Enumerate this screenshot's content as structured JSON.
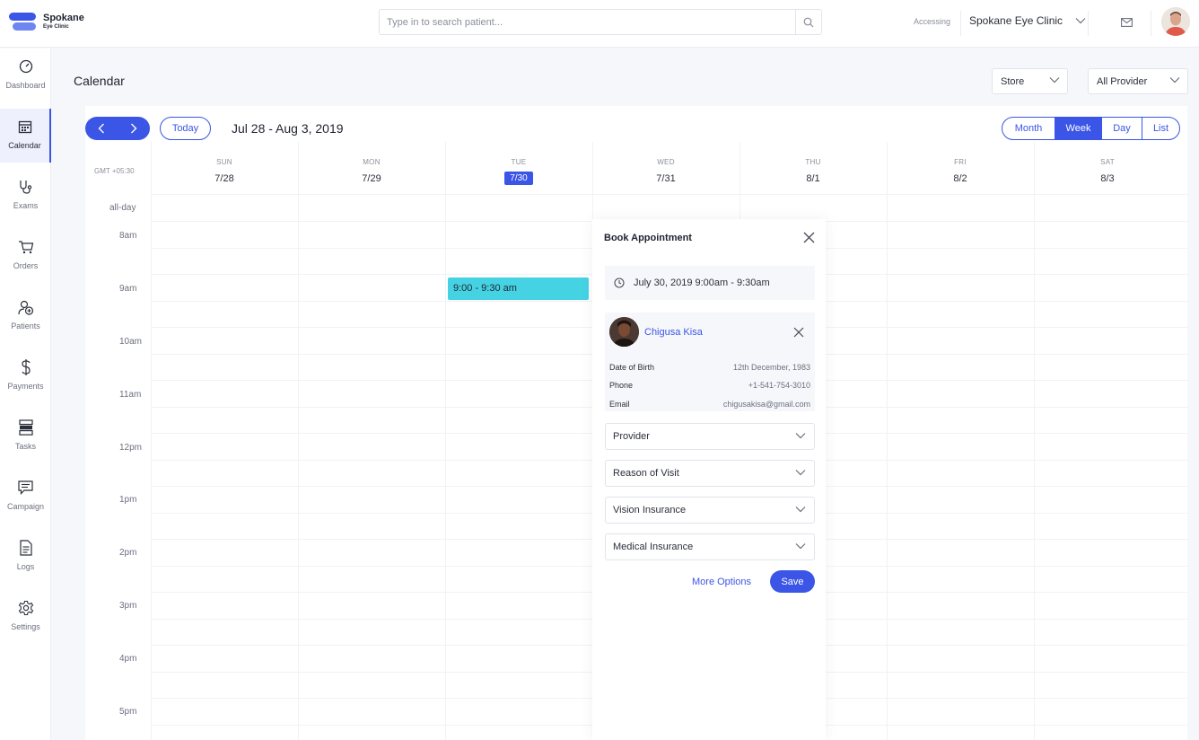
{
  "brand": {
    "name": "Spokane",
    "sub": "Eye Clinic"
  },
  "search": {
    "placeholder": "Type in to search patient..."
  },
  "header": {
    "accessing_label": "Accessing",
    "clinic": "Spokane Eye Clinic"
  },
  "sidebar": {
    "items": [
      {
        "label": "Dashboard",
        "icon": "speedometer-icon"
      },
      {
        "label": "Calendar",
        "icon": "calendar-icon",
        "active": true
      },
      {
        "label": "Exams",
        "icon": "stethoscope-icon"
      },
      {
        "label": "Orders",
        "icon": "cart-icon"
      },
      {
        "label": "Patients",
        "icon": "add-patient-icon"
      },
      {
        "label": "Payments",
        "icon": "dollar-icon"
      },
      {
        "label": "Tasks",
        "icon": "tasks-icon"
      },
      {
        "label": "Campaign",
        "icon": "message-icon"
      },
      {
        "label": "Logs",
        "icon": "document-icon"
      },
      {
        "label": "Settings",
        "icon": "gear-icon"
      }
    ]
  },
  "page": {
    "title": "Calendar",
    "store_select": "Store",
    "provider_select": "All Provider"
  },
  "calendar": {
    "today_label": "Today",
    "range": "Jul 28 - Aug 3, 2019",
    "views": [
      "Month",
      "Week",
      "Day",
      "List"
    ],
    "active_view": "Week",
    "timezone": "GMT +05:30",
    "allday_label": "all-day",
    "days": [
      {
        "name": "SUN",
        "date": "7/28"
      },
      {
        "name": "MON",
        "date": "7/29"
      },
      {
        "name": "TUE",
        "date": "7/30",
        "today": true
      },
      {
        "name": "WED",
        "date": "7/31"
      },
      {
        "name": "THU",
        "date": "8/1"
      },
      {
        "name": "FRI",
        "date": "8/2"
      },
      {
        "name": "SAT",
        "date": "8/3"
      }
    ],
    "hours": [
      "8am",
      "9am",
      "10am",
      "11am",
      "12pm",
      "1pm",
      "2pm",
      "3pm",
      "4pm",
      "5pm"
    ],
    "event": {
      "label": "9:00 - 9:30 am",
      "color": "#45d3e4"
    }
  },
  "popup": {
    "title": "Book Appointment",
    "datetime": "July 30, 2019 9:00am - 9:30am",
    "patient": {
      "name": "Chigusa Kisa",
      "dob_label": "Date of Birth",
      "dob": "12th December, 1983",
      "phone_label": "Phone",
      "phone": "+1-541-754-3010",
      "email_label": "Email",
      "email": "chigusakisa@gmail.com"
    },
    "fields": [
      "Provider",
      "Reason of Visit",
      "Vision Insurance",
      "Medical Insurance"
    ],
    "more_options": "More Options",
    "save": "Save"
  },
  "colors": {
    "accent": "#3b55e6",
    "event": "#45d3e4"
  }
}
